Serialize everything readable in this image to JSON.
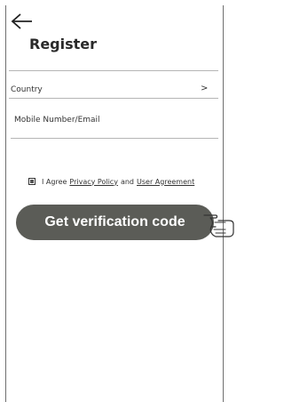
{
  "header": {
    "back_icon": "back-arrow-icon",
    "title": "Register"
  },
  "form": {
    "country_label": "Country",
    "country_chevron": ">",
    "mobile_email_label": "Mobile Number/Email"
  },
  "agreement": {
    "checked": true,
    "prefix": "I Agree",
    "privacy_policy": "Privacy Policy",
    "and": "and",
    "user_agreement": "User Agreement"
  },
  "cta": {
    "label": "Get verification code",
    "color": "#5b5c57"
  },
  "decor": {
    "pointer_icon": "pointing-hand-icon"
  }
}
